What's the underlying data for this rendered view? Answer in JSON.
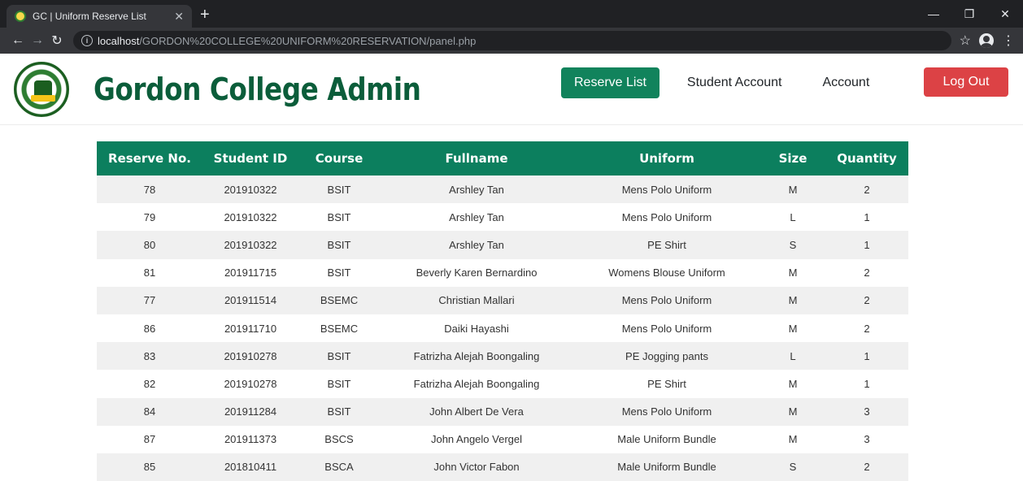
{
  "browser": {
    "tab_title": "GC | Uniform Reserve List",
    "new_tab": "+",
    "url_host": "localhost",
    "url_path": "/GORDON%20COLLEGE%20UNIFORM%20RESERVATION/panel.php"
  },
  "header": {
    "title": "Gordon College Admin",
    "nav": {
      "reserve_list": "Reserve List",
      "student_account": "Student Account",
      "account": "Account",
      "logout": "Log Out"
    },
    "accent_color": "#11835c",
    "logout_color": "#dc4245"
  },
  "table": {
    "columns": [
      "Reserve No.",
      "Student ID",
      "Course",
      "Fullname",
      "Uniform",
      "Size",
      "Quantity"
    ],
    "rows": [
      [
        "78",
        "201910322",
        "BSIT",
        "Arshley Tan",
        "Mens Polo Uniform",
        "M",
        "2"
      ],
      [
        "79",
        "201910322",
        "BSIT",
        "Arshley Tan",
        "Mens Polo Uniform",
        "L",
        "1"
      ],
      [
        "80",
        "201910322",
        "BSIT",
        "Arshley Tan",
        "PE Shirt",
        "S",
        "1"
      ],
      [
        "81",
        "201911715",
        "BSIT",
        "Beverly Karen Bernardino",
        "Womens Blouse Uniform",
        "M",
        "2"
      ],
      [
        "77",
        "201911514",
        "BSEMC",
        "Christian Mallari",
        "Mens Polo Uniform",
        "M",
        "2"
      ],
      [
        "86",
        "201911710",
        "BSEMC",
        "Daiki Hayashi",
        "Mens Polo Uniform",
        "M",
        "2"
      ],
      [
        "83",
        "201910278",
        "BSIT",
        "Fatrizha Alejah Boongaling",
        "PE Jogging pants",
        "L",
        "1"
      ],
      [
        "82",
        "201910278",
        "BSIT",
        "Fatrizha Alejah Boongaling",
        "PE Shirt",
        "M",
        "1"
      ],
      [
        "84",
        "201911284",
        "BSIT",
        "John Albert De Vera",
        "Mens Polo Uniform",
        "M",
        "3"
      ],
      [
        "87",
        "201911373",
        "BSCS",
        "John Angelo Vergel",
        "Male Uniform Bundle",
        "M",
        "3"
      ],
      [
        "85",
        "201810411",
        "BSCA",
        "John Victor Fabon",
        "Male Uniform Bundle",
        "S",
        "2"
      ]
    ]
  }
}
